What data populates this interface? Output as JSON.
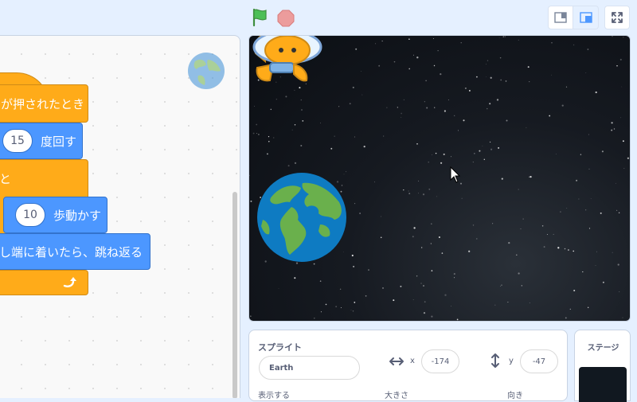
{
  "toolbar": {
    "green_flag_icon": "green-flag-icon",
    "stop_icon": "stop-icon",
    "colors": {
      "flag": "#4cbf56",
      "stop": "#ec9c9c"
    }
  },
  "code": {
    "blocks": {
      "when_flag": "が押されたとき",
      "turn_value": "15",
      "turn_label": "度回す",
      "forever_label": "と",
      "move_value": "10",
      "move_label": "歩動かす",
      "bounce_label": "し端に着いたら、跳ね返る"
    },
    "colors": {
      "event": "#ffab19",
      "motion": "#4c97ff"
    }
  },
  "sprite_info": {
    "sprite_label": "スプライト",
    "name_value": "Earth",
    "x_label": "x",
    "x_value": "-174",
    "y_label": "y",
    "y_value": "-47",
    "show_label": "表示する",
    "size_label": "大きさ",
    "direction_label": "向き"
  },
  "stage_panel": {
    "title": "ステージ"
  }
}
